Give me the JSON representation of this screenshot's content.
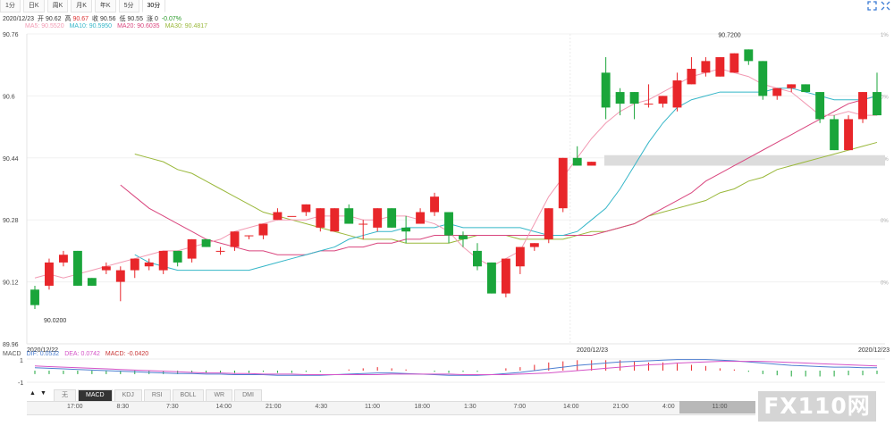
{
  "tabs": [
    {
      "label": "1分",
      "active": false
    },
    {
      "label": "日K",
      "active": false
    },
    {
      "label": "周K",
      "active": false
    },
    {
      "label": "月K",
      "active": false
    },
    {
      "label": "年K",
      "active": false
    },
    {
      "label": "5分",
      "active": false
    },
    {
      "label": "30分",
      "active": true
    }
  ],
  "quote": {
    "date": "2020/12/23",
    "open_label": "开",
    "open": "90.62",
    "high_label": "高",
    "high": "90.67",
    "close_label": "收",
    "close": "90.56",
    "low_label": "低",
    "low": "90.55",
    "change_label": "涨",
    "change": "0",
    "pct": "-0.07%"
  },
  "ma_legend": [
    {
      "text": "MA5: 90.5520",
      "color": "#f29ab3"
    },
    {
      "text": "MA10: 90.5950",
      "color": "#35b6c8"
    },
    {
      "text": "MA20: 90.6035",
      "color": "#d9467e"
    },
    {
      "text": "MA30: 90.4817",
      "color": "#9ab83b"
    }
  ],
  "macd_legend": [
    {
      "text": "MACD",
      "color": "#555"
    },
    {
      "text": "DIF: 0.0532",
      "color": "#4d7fd1"
    },
    {
      "text": "DEA: 0.0742",
      "color": "#d553c7"
    },
    {
      "text": "MACD: -0.0420",
      "color": "#c83535"
    }
  ],
  "bottom_tabs": [
    {
      "label": "无",
      "active": false
    },
    {
      "label": "MACD",
      "active": true
    },
    {
      "label": "KDJ",
      "active": false
    },
    {
      "label": "RSI",
      "active": false
    },
    {
      "label": "BOLL",
      "active": false
    },
    {
      "label": "WR",
      "active": false
    },
    {
      "label": "DMI",
      "active": false
    }
  ],
  "arrows": {
    "up": "▲",
    "down": "▼"
  },
  "nav_labels": [
    "17:00",
    "8:30",
    "7:30",
    "14:00",
    "21:00",
    "4:30",
    "11:00",
    "18:00",
    "1:30",
    "7:00",
    "14:00",
    "21:00",
    "4:00",
    "11:00"
  ],
  "logo": "FX110网",
  "chart_data": {
    "type": "candlestick",
    "ylim": [
      89.96,
      90.76
    ],
    "y_ticks": [
      "90.76",
      "90.6",
      "90.44",
      "90.28",
      "90.12",
      "89.96"
    ],
    "right_ticks": [
      "1%",
      "0%",
      "0%",
      "0%",
      "0%"
    ],
    "x_labels": [
      "2020/12/22",
      "2020/12/23",
      "2020/12/23"
    ],
    "annotations": {
      "max_label": "90.7200",
      "min_label": "90.0200"
    },
    "candles": [
      [
        90.1,
        90.06,
        90.11,
        90.05
      ],
      [
        90.11,
        90.17,
        90.18,
        90.1
      ],
      [
        90.17,
        90.19,
        90.2,
        90.16
      ],
      [
        90.2,
        90.11,
        90.2,
        90.11
      ],
      [
        90.13,
        90.11,
        90.13,
        90.11
      ],
      [
        90.15,
        90.16,
        90.17,
        90.14
      ],
      [
        90.12,
        90.15,
        90.16,
        90.07
      ],
      [
        90.15,
        90.18,
        90.18,
        90.13
      ],
      [
        90.16,
        90.17,
        90.18,
        90.15
      ],
      [
        90.15,
        90.2,
        90.2,
        90.14
      ],
      [
        90.2,
        90.17,
        90.2,
        90.16
      ],
      [
        90.18,
        90.23,
        90.23,
        90.17
      ],
      [
        90.23,
        90.21,
        90.23,
        90.21
      ],
      [
        90.2,
        90.2,
        90.21,
        90.19
      ],
      [
        90.21,
        90.25,
        90.25,
        90.2
      ],
      [
        90.24,
        90.24,
        90.24,
        90.23
      ],
      [
        90.24,
        90.27,
        90.27,
        90.23
      ],
      [
        90.28,
        90.3,
        90.31,
        90.28
      ],
      [
        90.29,
        90.29,
        90.29,
        90.29
      ],
      [
        90.3,
        90.32,
        90.32,
        90.29
      ],
      [
        90.26,
        90.31,
        90.31,
        90.25
      ],
      [
        90.25,
        90.31,
        90.31,
        90.25
      ],
      [
        90.31,
        90.27,
        90.32,
        90.27
      ],
      [
        90.27,
        90.27,
        90.28,
        90.23
      ],
      [
        90.26,
        90.31,
        90.31,
        90.25
      ],
      [
        90.31,
        90.26,
        90.31,
        90.26
      ],
      [
        90.26,
        90.25,
        90.29,
        90.22
      ],
      [
        90.27,
        90.3,
        90.31,
        90.27
      ],
      [
        90.3,
        90.34,
        90.35,
        90.29
      ],
      [
        90.3,
        90.24,
        90.3,
        90.22
      ],
      [
        90.24,
        90.23,
        90.25,
        90.21
      ],
      [
        90.2,
        90.16,
        90.22,
        90.15
      ],
      [
        90.17,
        90.09,
        90.17,
        90.09
      ],
      [
        90.09,
        90.18,
        90.18,
        90.08
      ],
      [
        90.16,
        90.21,
        90.21,
        90.14
      ],
      [
        90.21,
        90.22,
        90.22,
        90.2
      ],
      [
        90.23,
        90.31,
        90.31,
        90.22
      ],
      [
        90.31,
        90.44,
        90.44,
        90.3
      ],
      [
        90.44,
        90.42,
        90.47,
        90.42
      ],
      [
        90.42,
        90.43,
        90.43,
        90.42
      ],
      [
        90.66,
        90.57,
        90.7,
        90.54
      ],
      [
        90.61,
        90.58,
        90.62,
        90.55
      ],
      [
        90.61,
        90.58,
        90.61,
        90.54
      ],
      [
        90.58,
        90.58,
        90.63,
        90.57
      ],
      [
        90.58,
        90.6,
        90.6,
        90.57
      ],
      [
        90.57,
        90.64,
        90.66,
        90.56
      ],
      [
        90.63,
        90.67,
        90.7,
        90.63
      ],
      [
        90.66,
        90.69,
        90.7,
        90.65
      ],
      [
        90.65,
        90.7,
        90.7,
        90.65
      ],
      [
        90.66,
        90.71,
        90.71,
        90.66
      ],
      [
        90.72,
        90.69,
        90.72,
        90.68
      ],
      [
        90.69,
        90.6,
        90.69,
        90.59
      ],
      [
        90.6,
        90.62,
        90.62,
        90.59
      ],
      [
        90.62,
        90.63,
        90.63,
        90.61
      ],
      [
        90.63,
        90.61,
        90.63,
        90.61
      ],
      [
        90.61,
        90.54,
        90.61,
        90.53
      ],
      [
        90.54,
        90.46,
        90.55,
        90.46
      ],
      [
        90.46,
        90.54,
        90.55,
        90.46
      ],
      [
        90.54,
        90.61,
        90.61,
        90.53
      ],
      [
        90.61,
        90.55,
        90.66,
        90.55
      ]
    ],
    "ma5": [
      90.13,
      90.14,
      90.13,
      90.14,
      90.15,
      90.16,
      90.17,
      90.18,
      90.19,
      90.2,
      90.2,
      90.21,
      90.22,
      90.23,
      90.25,
      90.26,
      90.27,
      90.28,
      90.28,
      90.28,
      90.29,
      90.29,
      90.29,
      90.28,
      90.28,
      90.29,
      90.29,
      90.28,
      90.27,
      90.25,
      90.21,
      90.18,
      90.16,
      90.18,
      90.2,
      90.27,
      90.34,
      90.39,
      90.44,
      90.49,
      90.53,
      90.56,
      90.58,
      90.59,
      90.61,
      90.63,
      90.65,
      90.66,
      90.67,
      90.66,
      90.65,
      90.63,
      90.62,
      90.61,
      90.58,
      90.55,
      90.55,
      90.56,
      90.55,
      90.55
    ],
    "ma10": [
      90.19,
      90.17,
      90.16,
      90.15,
      90.15,
      90.15,
      90.15,
      90.15,
      90.15,
      90.16,
      90.17,
      90.18,
      90.19,
      90.2,
      90.21,
      90.23,
      90.24,
      90.25,
      90.25,
      90.26,
      90.26,
      90.26,
      90.27,
      90.26,
      90.26,
      90.26,
      90.26,
      90.26,
      90.25,
      90.24,
      90.24,
      90.25,
      90.28,
      90.31,
      90.36,
      90.42,
      90.48,
      90.53,
      90.57,
      90.59,
      90.6,
      90.61,
      90.61,
      90.61,
      90.61,
      90.62,
      90.62,
      90.61,
      90.6,
      90.59,
      90.59,
      90.59,
      90.6
    ],
    "ma20": [
      90.37,
      90.34,
      90.31,
      90.29,
      90.27,
      90.25,
      90.23,
      90.22,
      90.21,
      90.2,
      90.2,
      90.19,
      90.19,
      90.19,
      90.2,
      90.2,
      90.21,
      90.21,
      90.22,
      90.22,
      90.23,
      90.23,
      90.24,
      90.24,
      90.24,
      90.24,
      90.24,
      90.24,
      90.24,
      90.24,
      90.24,
      90.24,
      90.24,
      90.24,
      90.25,
      90.26,
      90.27,
      90.29,
      90.31,
      90.33,
      90.35,
      90.38,
      90.4,
      90.42,
      90.44,
      90.46,
      90.48,
      90.5,
      90.52,
      90.54,
      90.56,
      90.58,
      90.59,
      90.6
    ],
    "ma30": [
      90.45,
      90.44,
      90.43,
      90.41,
      90.4,
      90.38,
      90.36,
      90.34,
      90.32,
      90.3,
      90.29,
      90.28,
      90.27,
      90.26,
      90.25,
      90.24,
      90.23,
      90.23,
      90.23,
      90.22,
      90.22,
      90.22,
      90.22,
      90.23,
      90.24,
      90.24,
      90.24,
      90.23,
      90.23,
      90.23,
      90.23,
      90.24,
      90.25,
      90.25,
      90.26,
      90.27,
      90.29,
      90.3,
      90.31,
      90.32,
      90.33,
      90.35,
      90.36,
      90.38,
      90.39,
      90.41,
      90.42,
      90.43,
      90.44,
      90.45,
      90.46,
      90.47,
      90.48
    ],
    "dif": [
      0.05,
      0.04,
      0.03,
      0.02,
      0.01,
      0.0,
      -0.01,
      -0.02,
      -0.03,
      -0.04,
      -0.05,
      -0.05,
      -0.06,
      -0.06,
      -0.07,
      -0.07,
      -0.07,
      -0.08,
      -0.08,
      -0.08,
      -0.08,
      -0.07,
      -0.06,
      -0.05,
      -0.04,
      -0.04,
      -0.05,
      -0.06,
      -0.07,
      -0.08,
      -0.08,
      -0.08,
      -0.07,
      -0.05,
      -0.03,
      0.0,
      0.03,
      0.06,
      0.09,
      0.11,
      0.13,
      0.15,
      0.16,
      0.17,
      0.18,
      0.19,
      0.19,
      0.19,
      0.18,
      0.17,
      0.15,
      0.13,
      0.11,
      0.09,
      0.08,
      0.07,
      0.06,
      0.06,
      0.05,
      0.05
    ],
    "dea": [
      0.08,
      0.07,
      0.06,
      0.05,
      0.04,
      0.03,
      0.02,
      0.01,
      0.0,
      -0.01,
      -0.02,
      -0.03,
      -0.04,
      -0.04,
      -0.05,
      -0.05,
      -0.06,
      -0.06,
      -0.06,
      -0.07,
      -0.07,
      -0.07,
      -0.07,
      -0.07,
      -0.07,
      -0.06,
      -0.06,
      -0.06,
      -0.06,
      -0.06,
      -0.07,
      -0.07,
      -0.07,
      -0.07,
      -0.06,
      -0.05,
      -0.04,
      -0.02,
      0.0,
      0.02,
      0.04,
      0.06,
      0.08,
      0.1,
      0.11,
      0.13,
      0.14,
      0.15,
      0.16,
      0.16,
      0.16,
      0.16,
      0.15,
      0.14,
      0.13,
      0.12,
      0.11,
      0.1,
      0.09,
      0.08
    ],
    "macd_ylim": [
      -0.2,
      0.2
    ]
  }
}
